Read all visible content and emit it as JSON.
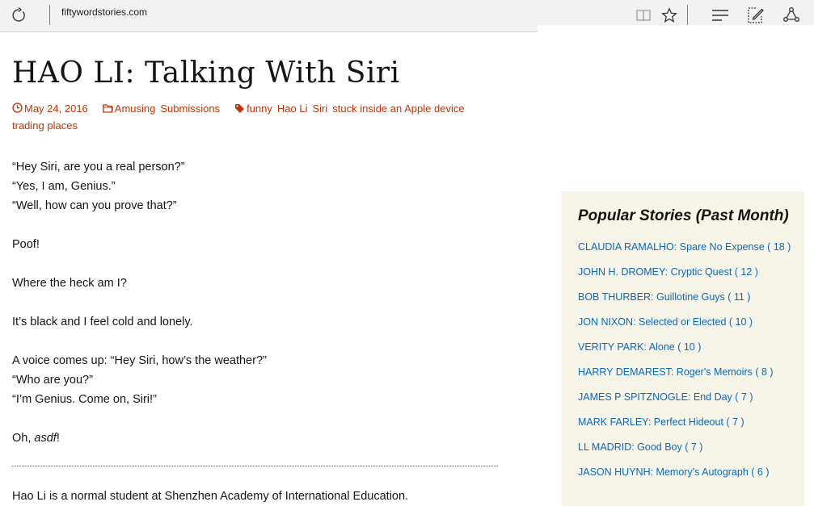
{
  "browser": {
    "url": "fiftywordstories.com",
    "icons": [
      "refresh-icon",
      "reading-view-icon",
      "favorite-star-icon",
      "hub-icon",
      "web-note-icon",
      "share-icon"
    ]
  },
  "post": {
    "title": "HAO LI: Talking With Siri",
    "date": "May 24, 2016",
    "categories": [
      "Amusing",
      "Submissions"
    ],
    "tags": [
      "funny",
      "Hao Li",
      "Siri",
      "stuck inside an Apple device",
      "trading places"
    ],
    "paragraphs": [
      [
        "“Hey Siri, are you a real person?”",
        "“Yes, I am, Genius.”",
        "“Well, how can you prove that?”"
      ],
      [
        "Poof!"
      ],
      [
        "Where the heck am I?"
      ],
      [
        "It’s black and I feel cold and lonely."
      ],
      [
        "A voice comes up: “Hey Siri, how’s the weather?”",
        "“Who are you?”",
        "“I’m Genius. Come on, Siri!”"
      ]
    ],
    "last_line_prefix": "Oh, ",
    "last_line_italic": "asdf",
    "last_line_suffix": "!",
    "bio": "Hao Li is a normal student at Shenzhen Academy of International Education."
  },
  "sidebar": {
    "title": "Popular Stories (Past Month)",
    "items": [
      "CLAUDIA RAMALHO: Spare No Expense ( 18 )",
      "JOHN H. DROMEY: Cryptic Quest ( 12 )",
      "BOB THURBER: Guillotine Guys ( 11 )",
      "JON NIXON: Selected or Elected ( 10 )",
      "VERITY PARK: Alone ( 10 )",
      "HARRY DEMAREST: Roger's Memoirs ( 8 )",
      "JAMES P SPITZNOGLE: End Day ( 7 )",
      "MARK FARLEY: Perfect Hideout ( 7 )",
      "LL MADRID: Good Boy ( 7 )",
      "JASON HUYNH: Memory's Autograph ( 6 )"
    ]
  },
  "colors": {
    "meta_link": "#bc360a",
    "sidebar_link": "#0a68bc",
    "sidebar_bg": "#f7f5e7",
    "toolbar_bg": "#f2f2f2"
  }
}
